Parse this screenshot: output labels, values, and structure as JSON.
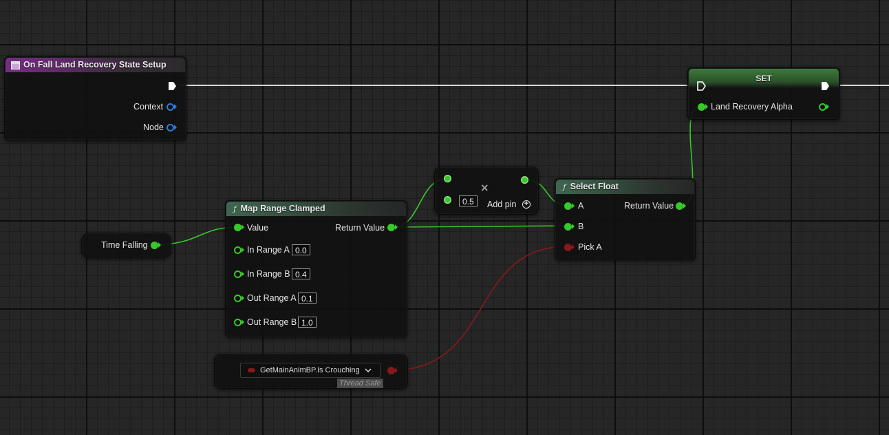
{
  "event_node": {
    "title": "On Fall Land Recovery State Setup",
    "pins": {
      "context": "Context",
      "node": "Node"
    }
  },
  "set_node": {
    "title": "SET",
    "pin": "Land Recovery Alpha"
  },
  "time_falling": {
    "label": "Time Falling"
  },
  "map_range": {
    "title": "Map Range Clamped",
    "value_label": "Value",
    "return_label": "Return Value",
    "in_range_a": {
      "label": "In Range A",
      "value": "0.0"
    },
    "in_range_b": {
      "label": "In Range B",
      "value": "0.4"
    },
    "out_range_a": {
      "label": "Out Range A",
      "value": "0.1"
    },
    "out_range_b": {
      "label": "Out Range B",
      "value": "1.0"
    }
  },
  "multiply": {
    "value": "0.5",
    "add_pin_label": "Add pin",
    "operator": "×"
  },
  "select_float": {
    "title": "Select Float",
    "a_label": "A",
    "b_label": "B",
    "pick_a_label": "Pick A",
    "return_label": "Return Value"
  },
  "getter": {
    "label": "GetMainAnimBP.Is Crouching",
    "badge": "Thread Safe"
  },
  "colors": {
    "float_pin": "#36c92a",
    "bool_pin": "#8a1818",
    "struct_pin": "#2f7bd9",
    "exec_wire": "#d8d8d8"
  },
  "icons": {
    "exec": "exec-arrow-icon",
    "function": "function-icon",
    "event": "event-icon",
    "add_pin": "add-circle-icon",
    "dropdown": "chevron-down-icon",
    "multiply": "multiply-icon"
  }
}
